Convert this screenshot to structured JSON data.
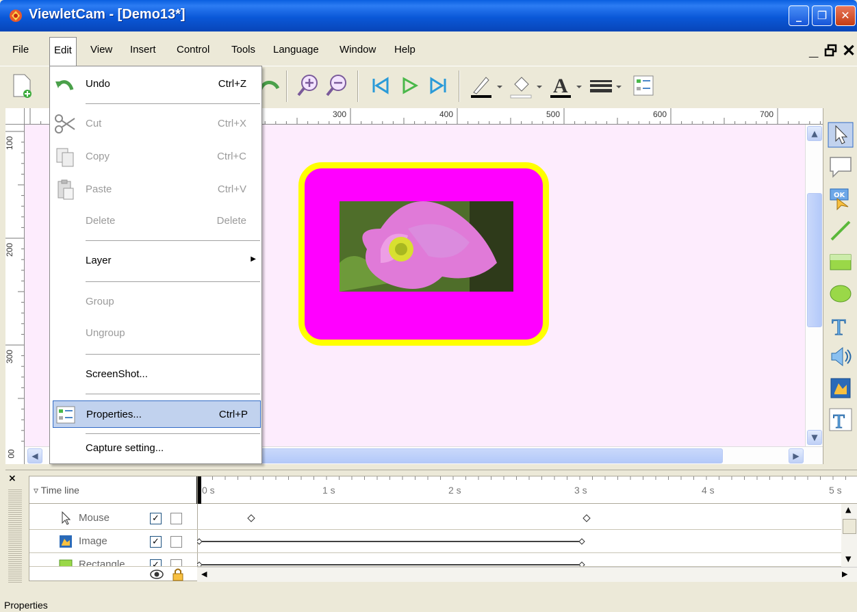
{
  "window": {
    "title": "ViewletCam - [Demo13*]",
    "min": "_",
    "max": "❐",
    "close": "✕"
  },
  "menubar": {
    "items": [
      "File",
      "Edit",
      "View",
      "Insert",
      "Control",
      "Tools",
      "Language",
      "Window",
      "Help"
    ],
    "mdi": {
      "min": "_",
      "restore": "🗗",
      "close": "✕"
    }
  },
  "ruler": {
    "top": [
      "300",
      "400",
      "500",
      "600",
      "700"
    ],
    "left": [
      "100",
      "200",
      "300"
    ],
    "corner_bottom": "00"
  },
  "edit_menu": {
    "items": [
      {
        "label": "Undo",
        "shortcut": "Ctrl+Z",
        "icon": "undo-icon",
        "enabled": true
      },
      {
        "label": "Cut",
        "shortcut": "Ctrl+X",
        "icon": "cut-icon",
        "enabled": false
      },
      {
        "label": "Copy",
        "shortcut": "Ctrl+C",
        "icon": "copy-icon",
        "enabled": false
      },
      {
        "label": "Paste",
        "shortcut": "Ctrl+V",
        "icon": "paste-icon",
        "enabled": false
      },
      {
        "label": "Delete",
        "shortcut": "Delete",
        "enabled": false
      },
      {
        "label": "Layer",
        "shortcut": "",
        "submenu": true,
        "enabled": true
      },
      {
        "label": "Group",
        "shortcut": "",
        "enabled": false
      },
      {
        "label": "Ungroup",
        "shortcut": "",
        "enabled": false
      },
      {
        "label": "ScreenShot...",
        "shortcut": "",
        "enabled": true
      },
      {
        "label": "Properties...",
        "shortcut": "Ctrl+P",
        "icon": "properties-icon",
        "enabled": true,
        "highlighted": true
      },
      {
        "label": "Capture setting...",
        "shortcut": "",
        "enabled": true
      }
    ]
  },
  "timeline": {
    "header": "Time line",
    "ticks": [
      "0 s",
      "1 s",
      "2 s",
      "3 s",
      "4 s",
      "5 s"
    ],
    "tracks": [
      {
        "label": "Mouse",
        "icon": "cursor-icon",
        "visible": "✓"
      },
      {
        "label": "Image",
        "icon": "image-icon",
        "visible": "✓"
      },
      {
        "label": "Rectangle",
        "icon": "rectangle-icon",
        "visible": "✓"
      }
    ]
  },
  "statusbar": {
    "text": "Properties"
  },
  "colors": {
    "canvas": "#fdecfd",
    "rect_fill": "#ff00ff",
    "rect_border": "#ffff00",
    "menu_highlight": "#c1d2ee"
  }
}
